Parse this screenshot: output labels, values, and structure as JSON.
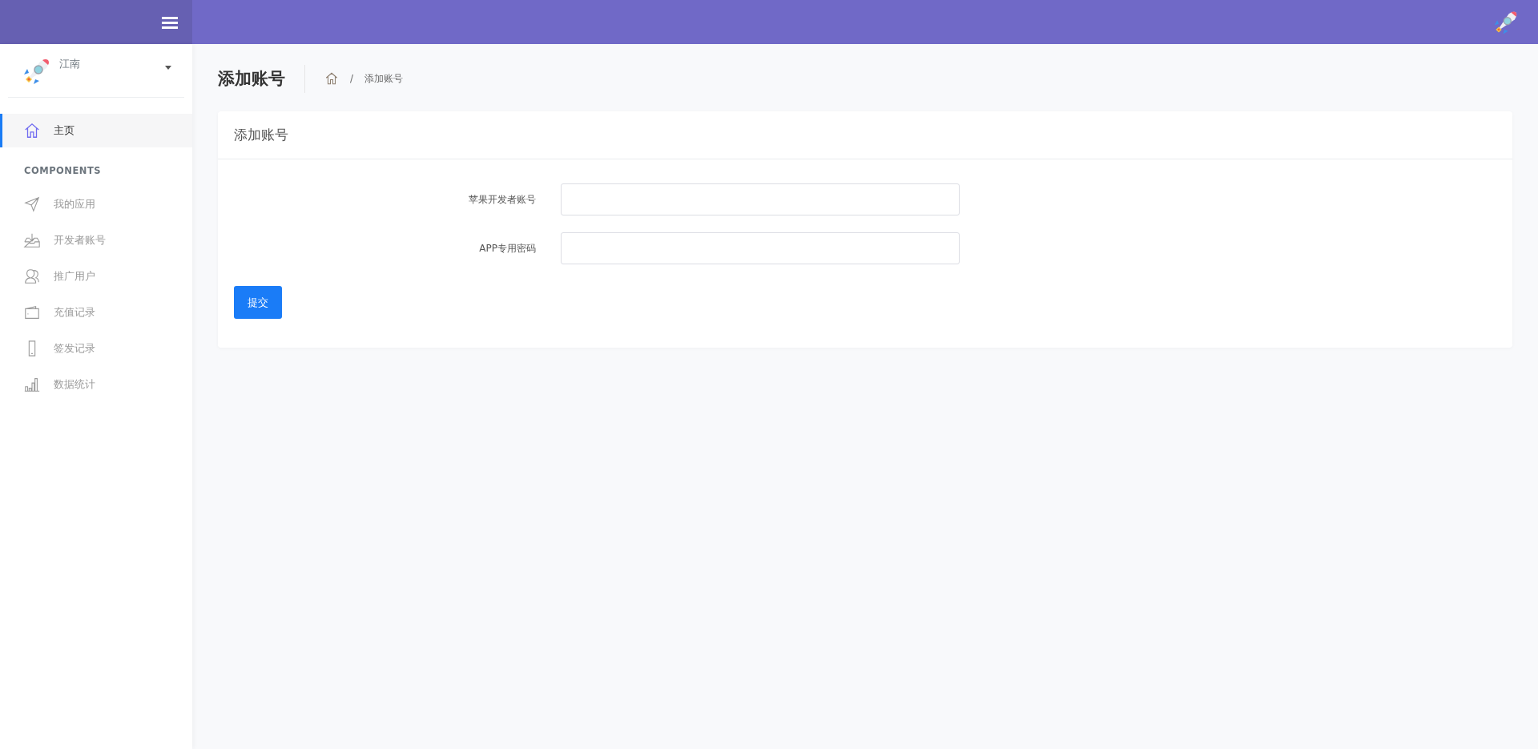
{
  "sidebar": {
    "user": {
      "name": "江南"
    },
    "items": [
      {
        "label": "主页",
        "selected": true
      }
    ],
    "section_title": "COMPONENTS",
    "components": [
      {
        "label": "我的应用",
        "selected": false
      },
      {
        "label": "开发者账号",
        "selected": false
      },
      {
        "label": "推广用户",
        "selected": false
      },
      {
        "label": "充值记录",
        "selected": false
      },
      {
        "label": "签发记录",
        "selected": false
      },
      {
        "label": "数据统计",
        "selected": false
      }
    ]
  },
  "page_title": "添加账号",
  "breadcrumb": {
    "separator": "/",
    "items": [
      "添加账号"
    ]
  },
  "card": {
    "title": "添加账号",
    "fields": [
      {
        "label": "苹果开发者账号"
      },
      {
        "label": "APP专用密码"
      }
    ],
    "submit": "提交"
  }
}
